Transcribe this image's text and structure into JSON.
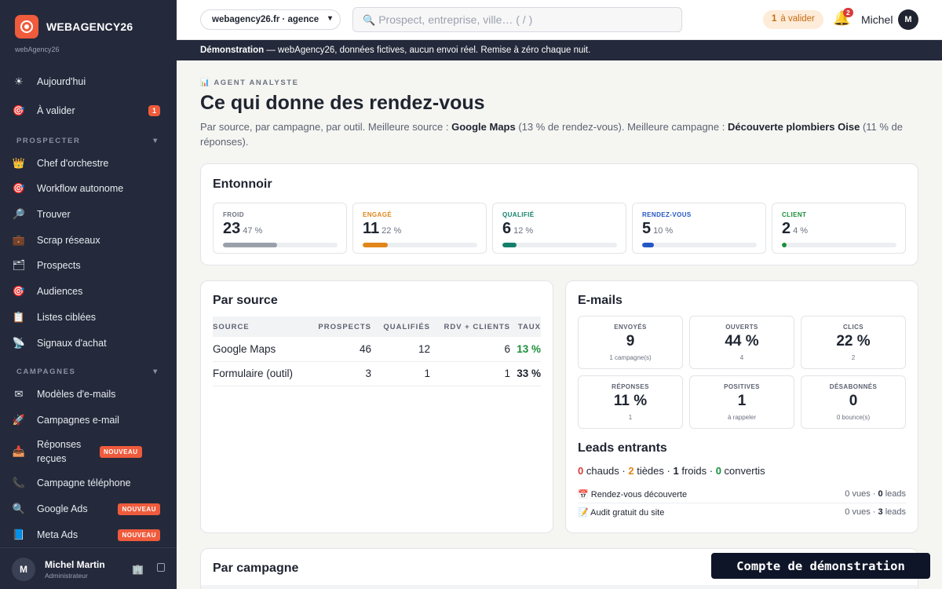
{
  "sidebar": {
    "brand": "WEBAGENCY26",
    "brand_sub": "webAgency26",
    "top_items": [
      {
        "icon": "☀",
        "label": "Aujourd'hui"
      },
      {
        "icon": "🎯",
        "label": "À valider",
        "count": "1"
      }
    ],
    "section_prospecter": "PROSPECTER",
    "prospecter_items": [
      {
        "icon": "👑",
        "label": "Chef d'orchestre"
      },
      {
        "icon": "🎯",
        "label": "Workflow autonome"
      },
      {
        "icon": "🔎",
        "label": "Trouver"
      },
      {
        "icon": "💼",
        "label": "Scrap réseaux"
      },
      {
        "icon": "🗂",
        "label": "Prospects"
      },
      {
        "icon": "🎯",
        "label": "Audiences"
      },
      {
        "icon": "📋",
        "label": "Listes ciblées"
      },
      {
        "icon": "📡",
        "label": "Signaux d'achat"
      }
    ],
    "section_campagnes": "CAMPAGNES",
    "campagnes_items": [
      {
        "icon": "✉",
        "label": "Modèles d'e-mails"
      },
      {
        "icon": "🚀",
        "label": "Campagnes e-mail"
      },
      {
        "icon": "📥",
        "label": "Réponses reçues",
        "badge": "NOUVEAU"
      },
      {
        "icon": "📞",
        "label": "Campagne téléphone"
      },
      {
        "icon": "🔍",
        "label": "Google Ads",
        "badge": "NOUVEAU"
      },
      {
        "icon": "📘",
        "label": "Meta Ads",
        "badge": "NOUVEAU"
      }
    ],
    "user": {
      "initial": "M",
      "name": "Michel Martin",
      "role": "Administrateur"
    }
  },
  "topbar": {
    "agency": "webagency26.fr · agence",
    "search_placeholder": "Prospect, entreprise, ville…  ( / )",
    "validate_count": "1",
    "validate_label": "à valider",
    "notif_count": "2",
    "user_name": "Michel",
    "user_initial": "M"
  },
  "banner": {
    "strong": "Démonstration",
    "text": " — webAgency26, données fictives, aucun envoi réel. Remise à zéro chaque nuit."
  },
  "page": {
    "kicker": "AGENT ANALYSTE",
    "title": "Ce qui donne des rendez-vous",
    "sub_1": "Par source, par campagne, par outil. Meilleure source : ",
    "best_source": "Google Maps",
    "sub_2": " (13 % de rendez-vous). Meilleure campagne : ",
    "best_campaign": "Découverte plombiers Oise",
    "sub_3": " (11 % de réponses)."
  },
  "funnel": {
    "title": "Entonnoir",
    "stages": [
      {
        "label": "FROID",
        "value": "23",
        "pct": "47 %",
        "fraction": 0.47,
        "color": "#9aa0ab"
      },
      {
        "label": "ENGAGÉ",
        "value": "11",
        "pct": "22 %",
        "fraction": 0.22,
        "color": "#e0861a"
      },
      {
        "label": "QUALIFIÉ",
        "value": "6",
        "pct": "12 %",
        "fraction": 0.12,
        "color": "#13806a"
      },
      {
        "label": "RENDEZ-VOUS",
        "value": "5",
        "pct": "10 %",
        "fraction": 0.1,
        "color": "#2457c5"
      },
      {
        "label": "CLIENT",
        "value": "2",
        "pct": "4 %",
        "fraction": 0.04,
        "color": "#1a8f3a"
      }
    ]
  },
  "by_source": {
    "title": "Par source",
    "headers": [
      "SOURCE",
      "PROSPECTS",
      "QUALIFIÉS",
      "RDV + CLIENTS",
      "TAUX"
    ],
    "rows": [
      [
        "Google Maps",
        "46",
        "12",
        "6",
        "13 %"
      ],
      [
        "Formulaire (outil)",
        "3",
        "1",
        "1",
        "33 %"
      ]
    ]
  },
  "emails": {
    "title": "E-mails",
    "stats": [
      {
        "label": "ENVOYÉS",
        "value": "9",
        "sub": "1 campagne(s)"
      },
      {
        "label": "OUVERTS",
        "value": "44 %",
        "sub": "4"
      },
      {
        "label": "CLICS",
        "value": "22 %",
        "sub": "2"
      },
      {
        "label": "RÉPONSES",
        "value": "11 %",
        "sub": "1"
      },
      {
        "label": "POSITIVES",
        "value": "1",
        "sub": "à rappeler"
      },
      {
        "label": "DÉSABONNÉS",
        "value": "0",
        "sub": "0 bounce(s)"
      }
    ]
  },
  "leads": {
    "title": "Leads entrants",
    "hot": "0",
    "hot_label": "chauds",
    "warm": "2",
    "warm_label": "tièdes",
    "cold": "1",
    "cold_label": "froids",
    "converted": "0",
    "converted_label": "convertis",
    "rows": [
      {
        "icon": "📅",
        "label": "Rendez-vous découverte",
        "views": "0",
        "views_label": "vues ·",
        "leads": "0",
        "leads_label": "leads"
      },
      {
        "icon": "📝",
        "label": "Audit gratuit du site",
        "views": "0",
        "views_label": "vues ·",
        "leads": "3",
        "leads_label": "leads"
      }
    ]
  },
  "by_campaign": {
    "title": "Par campagne"
  },
  "demo_tag": "Compte de démonstration"
}
